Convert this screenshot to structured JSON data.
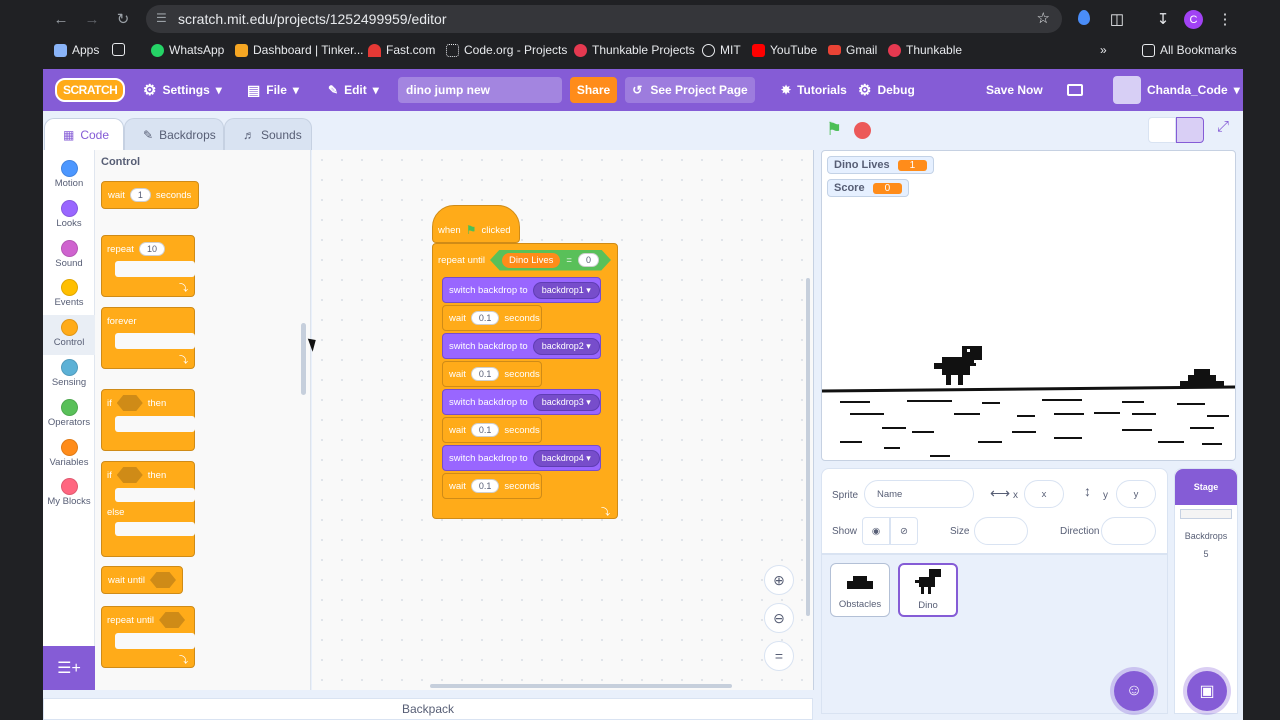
{
  "browser": {
    "url": "scratch.mit.edu/projects/1252499959/editor",
    "bookmarks": [
      "Apps",
      "WhatsApp",
      "Dashboard | Tinker...",
      "Fast.com",
      "Code.org - Projects",
      "Thunkable Projects",
      "MIT",
      "YouTube",
      "Gmail",
      "Thunkable"
    ],
    "all_bookmarks": "All Bookmarks",
    "profile_initial": "C"
  },
  "menu": {
    "logo": "SCRATCH",
    "settings": "Settings",
    "file": "File",
    "edit": "Edit",
    "project_title": "dino jump new",
    "share": "Share",
    "see_project": "See Project Page",
    "tutorials": "Tutorials",
    "debug": "Debug",
    "save_now": "Save Now",
    "username": "Chanda_Code"
  },
  "tabs": {
    "code": "Code",
    "backdrops": "Backdrops",
    "sounds": "Sounds"
  },
  "categories": [
    {
      "label": "Motion",
      "color": "#4c97ff"
    },
    {
      "label": "Looks",
      "color": "#9966ff"
    },
    {
      "label": "Sound",
      "color": "#cf63cf"
    },
    {
      "label": "Events",
      "color": "#ffbf00"
    },
    {
      "label": "Control",
      "color": "#ffab19"
    },
    {
      "label": "Sensing",
      "color": "#5cb1d6"
    },
    {
      "label": "Operators",
      "color": "#59c059"
    },
    {
      "label": "Variables",
      "color": "#ff8c1a"
    },
    {
      "label": "My Blocks",
      "color": "#ff6680"
    }
  ],
  "palette": {
    "heading": "Control",
    "wait": "wait",
    "wait_value": "1",
    "seconds": "seconds",
    "repeat": "repeat",
    "repeat_value": "10",
    "forever": "forever",
    "if": "if",
    "then": "then",
    "else": "else",
    "wait_until": "wait until",
    "repeat_until": "repeat until"
  },
  "script": {
    "when": "when",
    "clicked": "clicked",
    "repeat_until": "repeat until",
    "variable": "Dino Lives",
    "equals": "=",
    "compare_value": "0",
    "switch_backdrop": "switch backdrop to",
    "wait": "wait",
    "seconds": "seconds",
    "steps": [
      {
        "backdrop": "backdrop1",
        "wait": "0.1"
      },
      {
        "backdrop": "backdrop2",
        "wait": "0.1"
      },
      {
        "backdrop": "backdrop3",
        "wait": "0.1"
      },
      {
        "backdrop": "backdrop4",
        "wait": "0.1"
      }
    ]
  },
  "stage": {
    "monitors": [
      {
        "label": "Dino Lives",
        "value": "1"
      },
      {
        "label": "Score",
        "value": "0"
      }
    ]
  },
  "sprite_info": {
    "sprite_label": "Sprite",
    "name_placeholder": "Name",
    "x_label": "x",
    "x_placeholder": "x",
    "y_label": "y",
    "y_placeholder": "y",
    "show_label": "Show",
    "size_label": "Size",
    "direction_label": "Direction"
  },
  "sprites": [
    {
      "name": "Obstacles"
    },
    {
      "name": "Dino"
    }
  ],
  "stage_panel": {
    "title": "Stage",
    "backdrops_label": "Backdrops",
    "backdrops_count": "5"
  },
  "backpack": "Backpack"
}
